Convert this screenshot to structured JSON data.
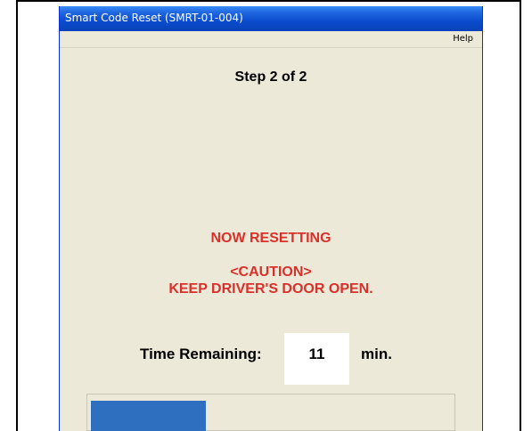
{
  "window": {
    "title": "Smart Code Reset (SMRT-01-004)"
  },
  "menu": {
    "help": "Help"
  },
  "content": {
    "step": "Step 2 of 2",
    "status": "NOW RESETTING",
    "caution_title": "<CAUTION>",
    "caution_message": "KEEP DRIVER'S DOOR OPEN.",
    "time_label": "Time Remaining:",
    "time_value": "11",
    "time_unit": "min."
  },
  "progress": {
    "fraction": 0.32
  },
  "colors": {
    "warning_text": "#d9302a",
    "progress_fill": "#2f6fc0",
    "window_bg": "#ece9d8",
    "titlebar": "#0a4ccd"
  }
}
